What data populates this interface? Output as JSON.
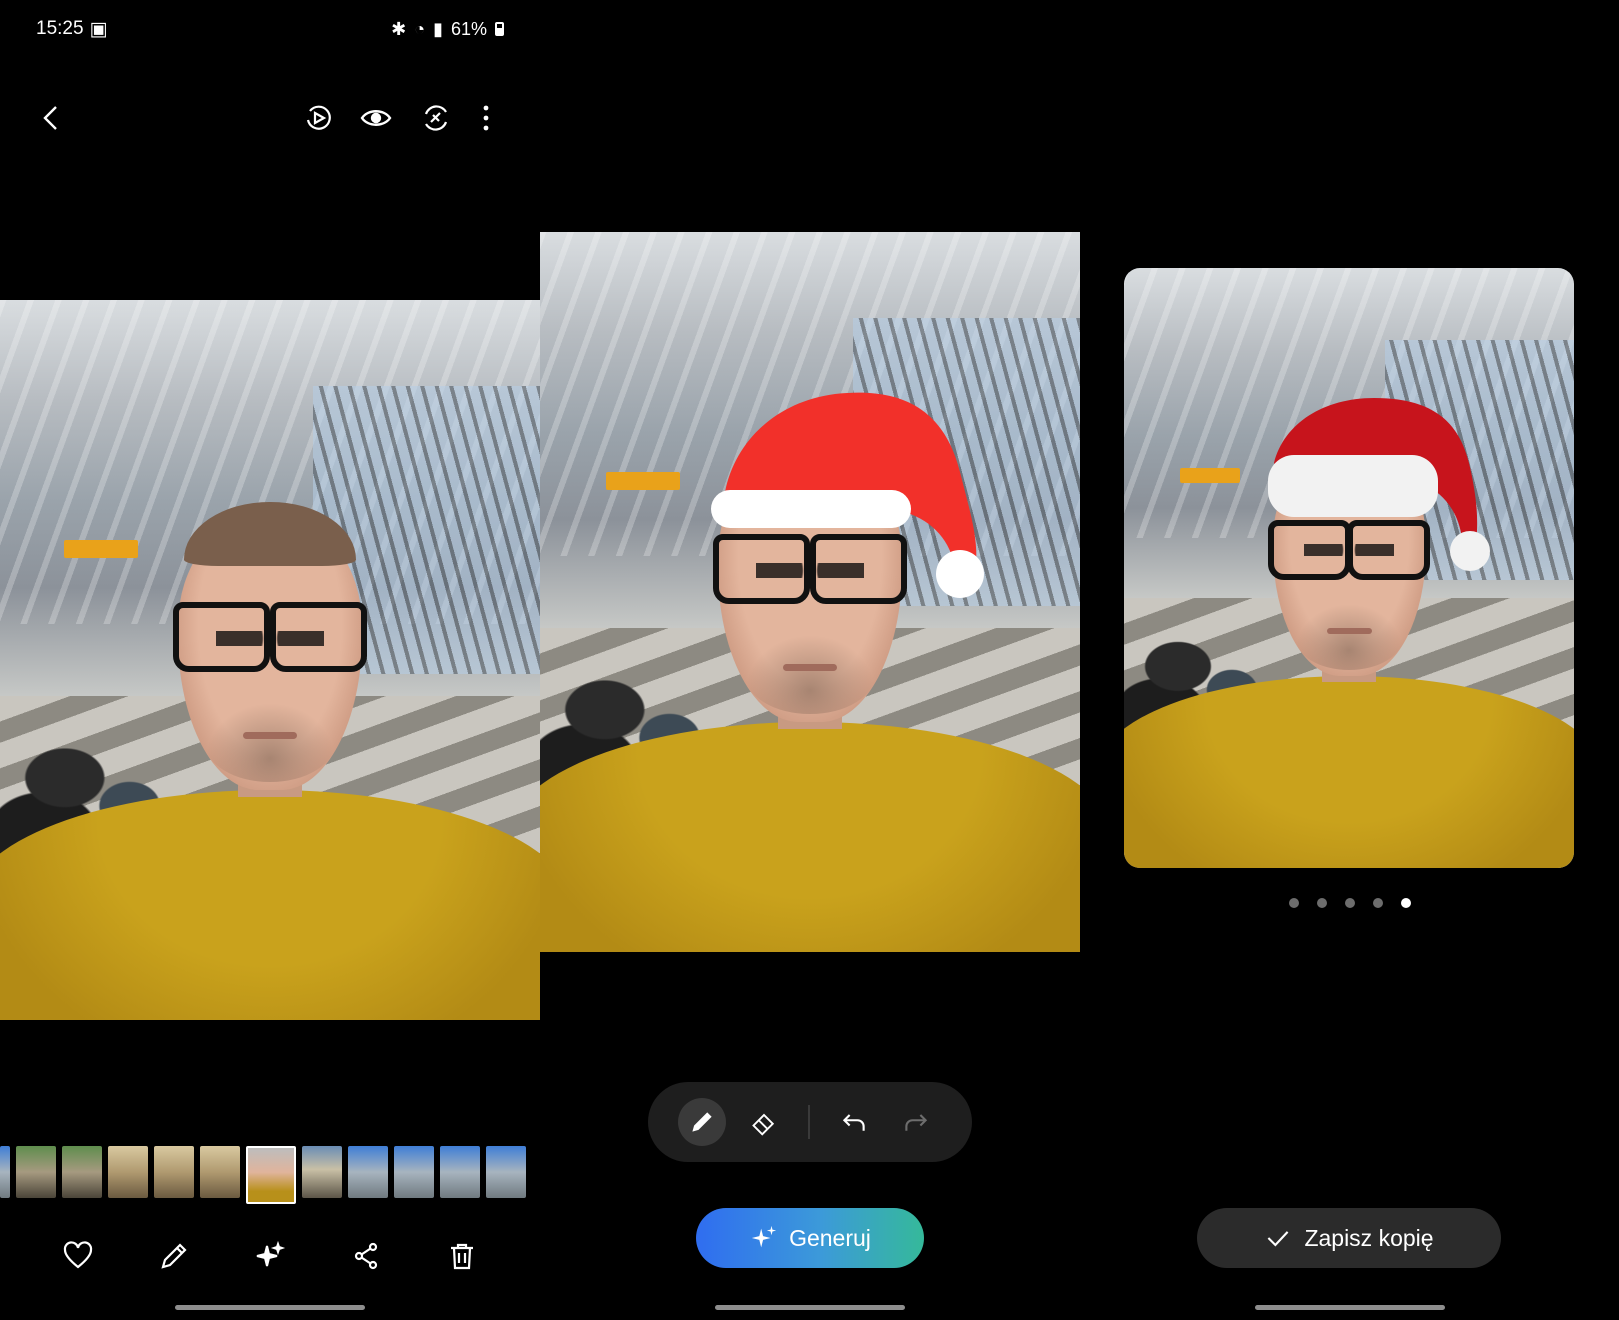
{
  "status_bar": {
    "time": "15:25",
    "battery": "61%"
  },
  "screen1": {
    "top_icons": [
      "back-arrow-icon",
      "motion-play-icon",
      "eye-icon",
      "remaster-icon",
      "more-options-icon"
    ],
    "filmstrip_count": 12,
    "actions": [
      "heart-icon",
      "pencil-icon",
      "sparkle-icon",
      "share-icon",
      "trash-icon"
    ]
  },
  "screen2": {
    "tools": [
      "pen-icon",
      "eraser-icon",
      "undo-icon",
      "redo-icon"
    ],
    "generate_label": "Generuj",
    "hat_colors": {
      "red": "#f2302a",
      "white": "#ffffff"
    }
  },
  "screen3": {
    "page_count": 5,
    "active_page": 5,
    "save_label": "Zapisz kopię",
    "hat_colors": {
      "red": "#c7141c",
      "white": "#f2f2f2"
    }
  },
  "colors": {
    "background": "#000000",
    "accent_blue": "#2f6df0",
    "accent_teal": "#35b99a",
    "shirt": "#c9a21c"
  }
}
